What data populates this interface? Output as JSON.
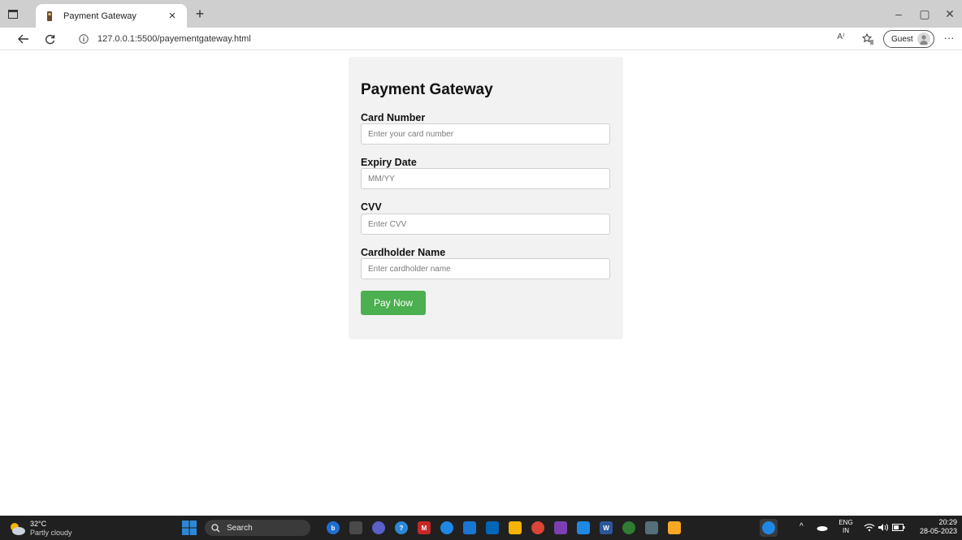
{
  "browser": {
    "tab_title": "Payment Gateway",
    "tab_close": "×",
    "new_tab": "+",
    "address": "127.0.0.1:5500/payementgateway.html",
    "read_aloud": "A⁾",
    "profile_label": "Guest",
    "more": "···",
    "window_minimize": "–",
    "window_restore": "▢",
    "window_close": "✕"
  },
  "form": {
    "title": "Payment Gateway",
    "fields": [
      {
        "label": "Card Number",
        "placeholder": "Enter your card number"
      },
      {
        "label": "Expiry Date",
        "placeholder": "MM/YY"
      },
      {
        "label": "CVV",
        "placeholder": "Enter CVV"
      },
      {
        "label": "Cardholder Name",
        "placeholder": "Enter cardholder name"
      }
    ],
    "submit_label": "Pay Now",
    "colors": {
      "card_bg": "#f2f2f2",
      "button": "#4caf50"
    }
  },
  "taskbar": {
    "weather_temp": "32°C",
    "weather_desc": "Partly cloudy",
    "search_label": "Search",
    "lang_top": "ENG",
    "lang_bottom": "IN",
    "time": "20:29",
    "date": "28-05-2023"
  }
}
